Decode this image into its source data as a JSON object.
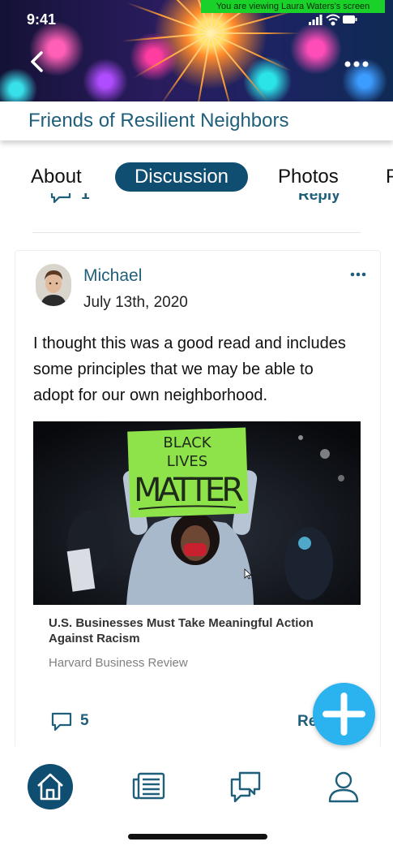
{
  "status_bar": {
    "time": "9:41",
    "share_banner": "You are viewing Laura Waters's screen"
  },
  "header": {
    "group_title": "Friends of Resilient Neighbors"
  },
  "tabs": [
    {
      "label": "About",
      "active": false
    },
    {
      "label": "Discussion",
      "active": true
    },
    {
      "label": "Photos",
      "active": false
    },
    {
      "label": "P",
      "active": false
    }
  ],
  "prev_post": {
    "comment_count": "1",
    "reply_label": "Reply"
  },
  "post": {
    "author": "Michael",
    "date": "July 13th, 2020",
    "body": "I thought this was a good read and includes some principles that we may be able to adopt for our own neighborhood.",
    "article": {
      "sign_text": [
        "BLACK",
        "LIVES",
        "MATTER"
      ],
      "title": "U.S. Businesses Must Take Meaningful Action Against Racism",
      "source": "Harvard Business Review"
    },
    "comment_count": "5",
    "reply_label": "Re"
  },
  "bottom_nav": {
    "items": [
      {
        "icon": "home-icon",
        "active": true
      },
      {
        "icon": "newspaper-icon",
        "active": false
      },
      {
        "icon": "chat-icon",
        "active": false
      },
      {
        "icon": "profile-icon",
        "active": false
      }
    ]
  },
  "colors": {
    "brand": "#0f4d71",
    "link": "#1f5f7a",
    "fab": "#2bb3ef",
    "share_banner": "#1ad12a"
  }
}
